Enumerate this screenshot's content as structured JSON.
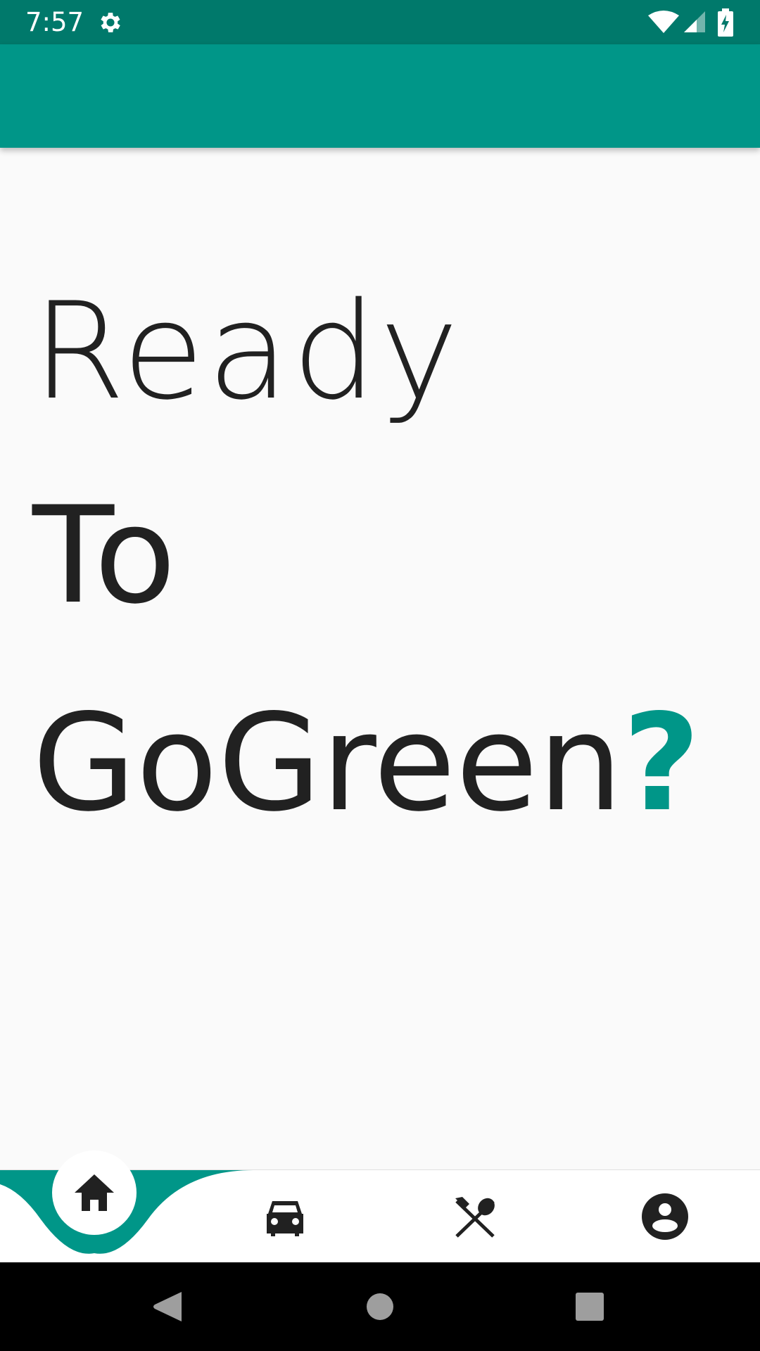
{
  "status_bar": {
    "time": "7:57",
    "icons": [
      "gear-icon",
      "wifi-icon",
      "signal-icon",
      "battery-charging-icon"
    ],
    "background_color": "#00796b"
  },
  "app_bar": {
    "background_color": "#009688"
  },
  "hero": {
    "line1": "Ready",
    "line2": "To",
    "line3": "GoGreen",
    "accent_mark": "?",
    "text_color": "#212121",
    "accent_color": "#009688"
  },
  "bottom_nav": {
    "items": [
      {
        "icon": "home-icon",
        "selected": true
      },
      {
        "icon": "car-icon",
        "selected": false
      },
      {
        "icon": "utensils-icon",
        "selected": false
      },
      {
        "icon": "account-icon",
        "selected": false
      }
    ],
    "accent_color": "#009688"
  },
  "system_nav": {
    "buttons": [
      "back-icon",
      "home-circle-icon",
      "recents-icon"
    ]
  }
}
